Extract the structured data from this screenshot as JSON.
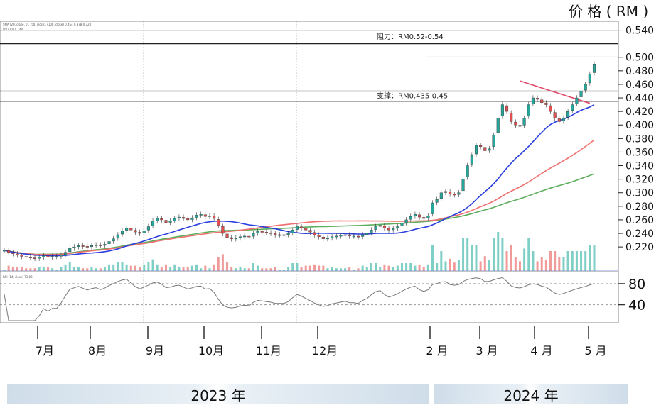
{
  "header": {
    "price_label": "价 格 ( RM )"
  },
  "indicator_legends": {
    "ma_legend": "SMA (20, close, 0), (50, close), (100, close) 0.454 0.378 0.328",
    "volume_legend": "Vol (20) 0.140",
    "rsi_legend": "RSI (14, close) 73.08"
  },
  "chart_data": {
    "type": "candlestick",
    "title": "",
    "ylabel": "价格 (RM)",
    "xlabel": "",
    "months": [
      "7月",
      "8月",
      "9月",
      "10月",
      "11月",
      "12月",
      "2 月",
      "3 月",
      "4 月",
      "5 月"
    ],
    "years": [
      "2023 年",
      "2024 年"
    ],
    "price_ticks": [
      "0.540",
      "0.500",
      "0.480",
      "0.460",
      "0.440",
      "0.420",
      "0.400",
      "0.380",
      "0.360",
      "0.340",
      "0.320",
      "0.300",
      "0.280",
      "0.260",
      "0.240",
      "0.220"
    ],
    "rsi_ticks": [
      "80",
      "40"
    ],
    "ylim": [
      0.195,
      0.55
    ],
    "rsi_ylim": [
      10,
      100
    ],
    "zones": [
      {
        "name": "resistance",
        "label": "阻力：RM0.52-0.54",
        "low": 0.52,
        "high": 0.54
      },
      {
        "name": "support",
        "label": "支撑：RM0.435-0.45",
        "low": 0.435,
        "high": 0.45
      }
    ],
    "close": [
      0.215,
      0.212,
      0.21,
      0.208,
      0.206,
      0.205,
      0.204,
      0.203,
      0.205,
      0.207,
      0.205,
      0.206,
      0.206,
      0.208,
      0.212,
      0.218,
      0.22,
      0.222,
      0.221,
      0.22,
      0.222,
      0.223,
      0.222,
      0.224,
      0.228,
      0.232,
      0.238,
      0.244,
      0.248,
      0.245,
      0.242,
      0.24,
      0.244,
      0.25,
      0.258,
      0.262,
      0.26,
      0.256,
      0.258,
      0.262,
      0.264,
      0.262,
      0.26,
      0.263,
      0.267,
      0.268,
      0.265,
      0.266,
      0.262,
      0.252,
      0.24,
      0.234,
      0.232,
      0.233,
      0.235,
      0.236,
      0.235,
      0.24,
      0.243,
      0.242,
      0.241,
      0.24,
      0.238,
      0.238,
      0.238,
      0.24,
      0.245,
      0.25,
      0.248,
      0.245,
      0.242,
      0.238,
      0.235,
      0.232,
      0.233,
      0.235,
      0.236,
      0.237,
      0.238,
      0.236,
      0.236,
      0.235,
      0.238,
      0.24,
      0.245,
      0.25,
      0.252,
      0.248,
      0.245,
      0.247,
      0.25,
      0.255,
      0.26,
      0.265,
      0.268,
      0.264,
      0.262,
      0.266,
      0.285,
      0.29,
      0.3,
      0.302,
      0.298,
      0.297,
      0.3,
      0.32,
      0.34,
      0.355,
      0.37,
      0.368,
      0.362,
      0.365,
      0.385,
      0.41,
      0.43,
      0.42,
      0.405,
      0.4,
      0.398,
      0.41,
      0.43,
      0.44,
      0.438,
      0.433,
      0.43,
      0.42,
      0.41,
      0.405,
      0.41,
      0.42,
      0.43,
      0.44,
      0.45,
      0.46,
      0.475,
      0.49
    ],
    "sma20_end": 0.43,
    "sma50_end": 0.378,
    "sma100_end": 0.328,
    "rsi_last": 73.08
  }
}
